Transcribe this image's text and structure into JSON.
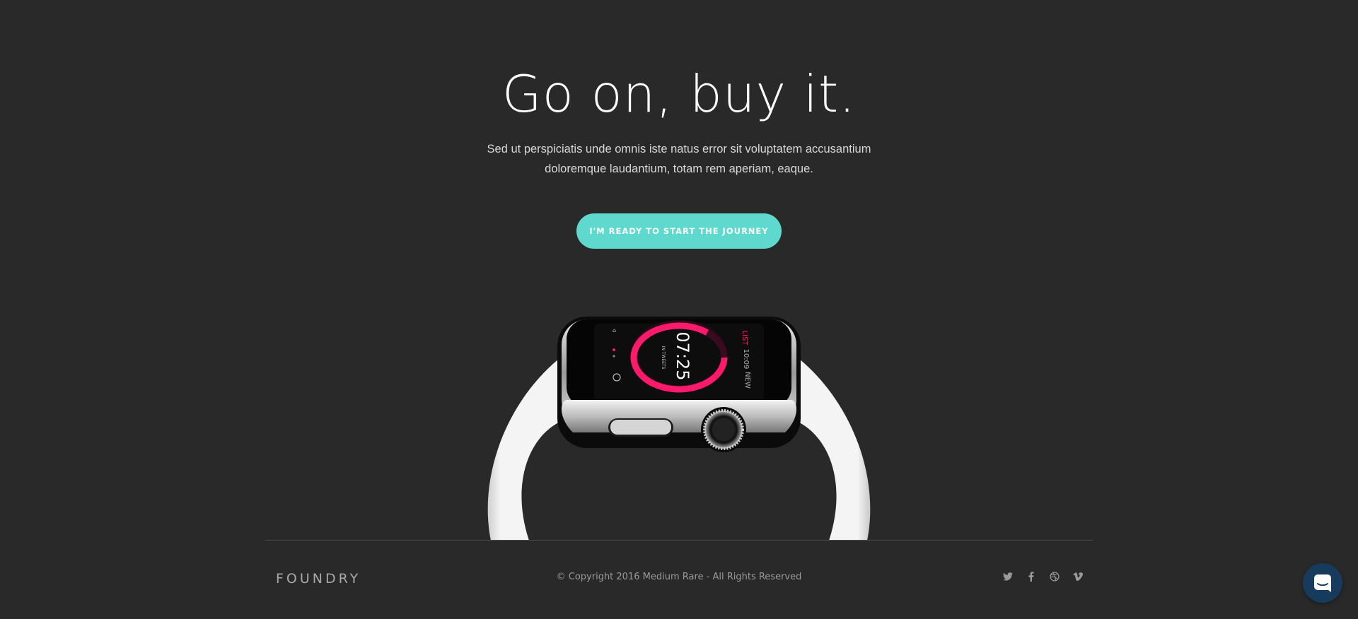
{
  "hero": {
    "title": "Go on, buy it.",
    "lead_line1": "Sed ut perspiciatis unde omnis iste natus error sit voluptatem accusantium",
    "lead_line2": "doloremque laudantium, totam rem aperiam, eaque.",
    "cta_label": "I'M READY TO START THE JOURNEY"
  },
  "watch_screen": {
    "time": "07:25",
    "left_label": "LIST",
    "right_top": "10:09",
    "right_bottom": "NEW",
    "sub_label": "IN TWEETS"
  },
  "footer": {
    "logo": "FOUNDRY",
    "copyright": "© Copyright 2016 Medium Rare - All Rights Reserved",
    "social_icons": [
      "twitter-icon",
      "facebook-icon",
      "dribbble-icon",
      "vimeo-icon"
    ]
  },
  "chat": {
    "icon": "chat-icon"
  },
  "colors": {
    "background": "#292929",
    "accent": "#5fd9cd",
    "chat_bubble": "#163b5d",
    "watch_ring": "#ff1a6c"
  }
}
